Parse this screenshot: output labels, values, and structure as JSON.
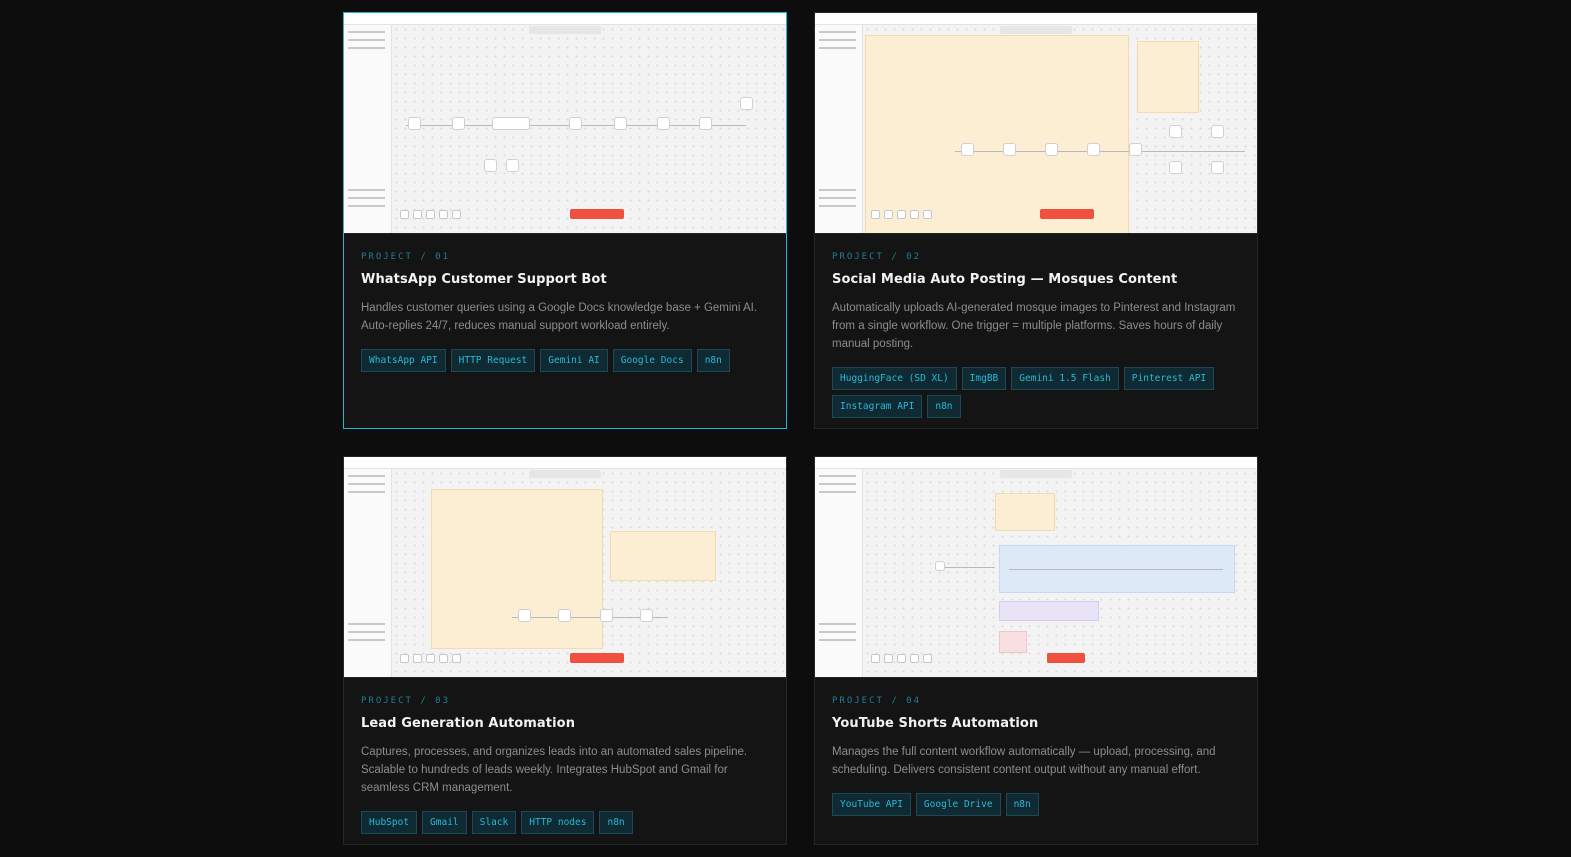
{
  "projects": [
    {
      "label": "PROJECT / 01",
      "title": "WhatsApp Customer Support Bot",
      "description": "Handles customer queries using a Google Docs knowledge base + Gemini AI. Auto-replies 24/7, reduces manual support workload entirely.",
      "tags": [
        "WhatsApp API",
        "HTTP Request",
        "Gemini AI",
        "Google Docs",
        "n8n"
      ]
    },
    {
      "label": "PROJECT / 02",
      "title": "Social Media Auto Posting — Mosques Content",
      "description": "Automatically uploads AI-generated mosque images to Pinterest and Instagram from a single workflow. One trigger = multiple platforms. Saves hours of daily manual posting.",
      "tags": [
        "HuggingFace (SD XL)",
        "ImgBB",
        "Gemini 1.5 Flash",
        "Pinterest API",
        "Instagram API",
        "n8n"
      ]
    },
    {
      "label": "PROJECT / 03",
      "title": "Lead Generation Automation",
      "description": "Captures, processes, and organizes leads into an automated sales pipeline. Scalable to hundreds of leads weekly. Integrates HubSpot and Gmail for seamless CRM management.",
      "tags": [
        "HubSpot",
        "Gmail",
        "Slack",
        "HTTP nodes",
        "n8n"
      ]
    },
    {
      "label": "PROJECT / 04",
      "title": "YouTube Shorts Automation",
      "description": "Manages the full content workflow automatically — upload, processing, and scheduling. Delivers consistent content output without any manual effort.",
      "tags": [
        "YouTube API",
        "Google Drive",
        "n8n"
      ]
    }
  ],
  "colors": {
    "accent": "#1fb6d3",
    "background": "#0d0d0e",
    "card": "#141415",
    "execute_button": "#f0513f"
  }
}
